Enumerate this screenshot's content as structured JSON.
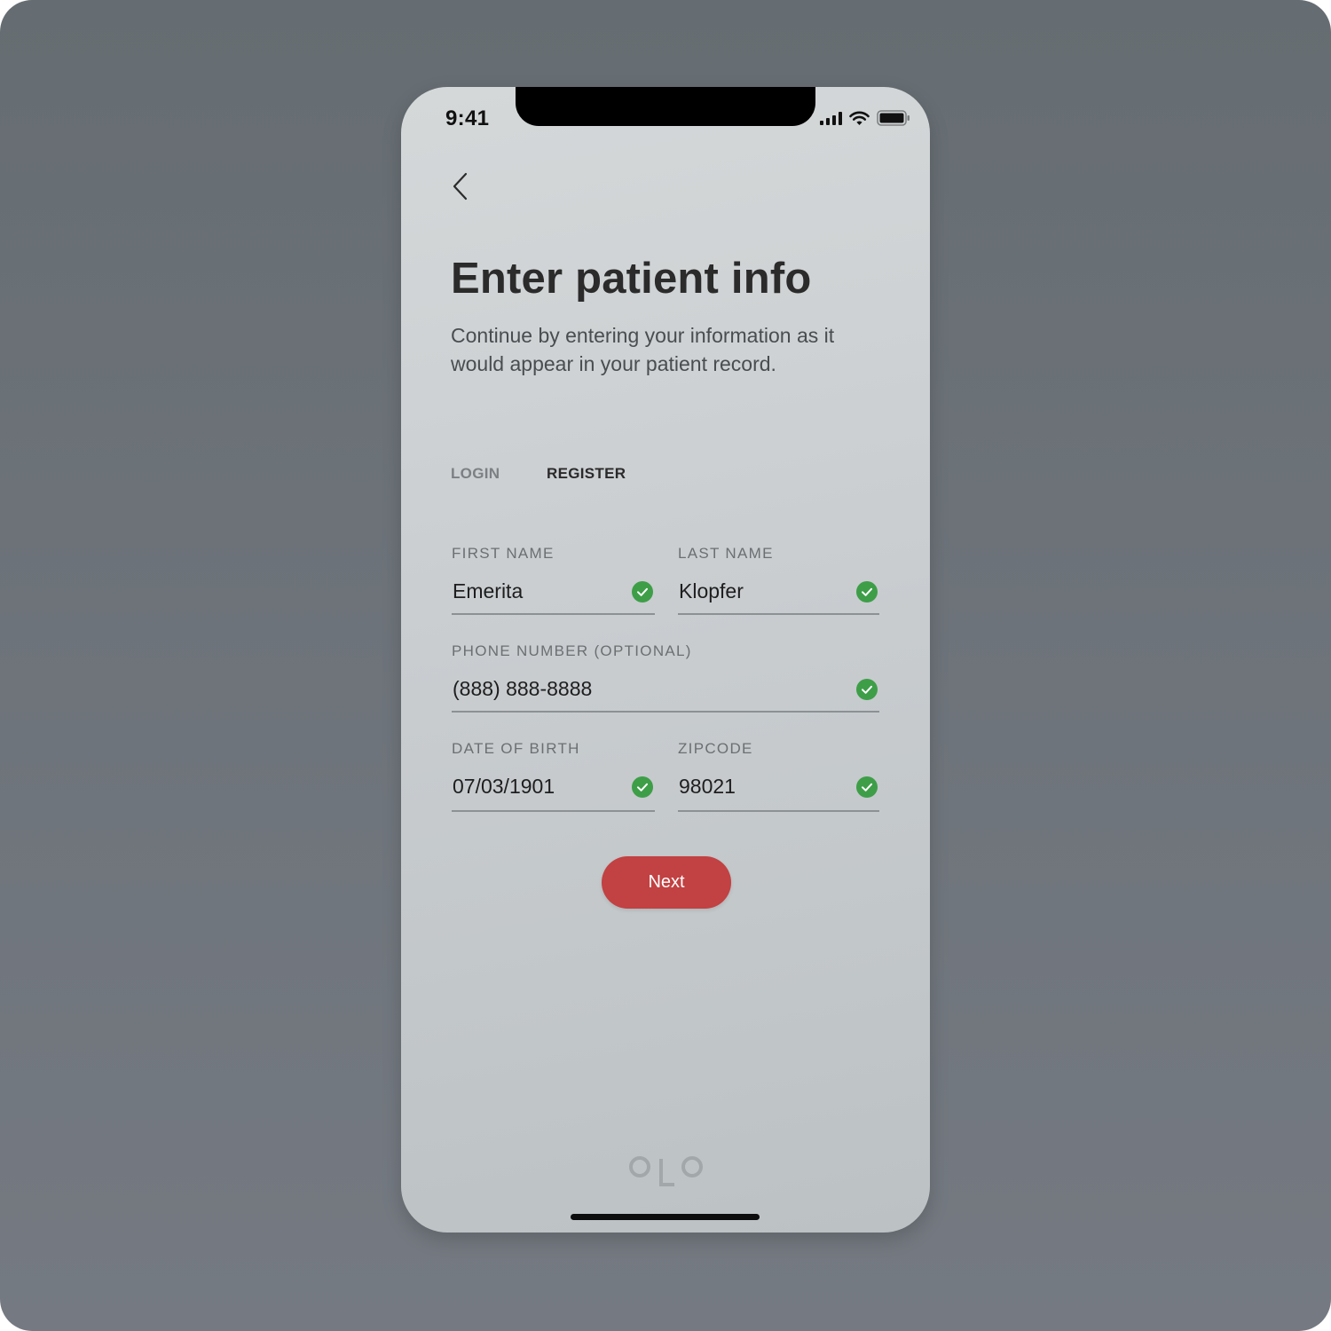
{
  "status_bar": {
    "time": "9:41",
    "icons": [
      "cellular-signal-icon",
      "wifi-icon",
      "battery-icon"
    ]
  },
  "header": {
    "back_icon": "chevron-left-icon",
    "title": "Enter patient info",
    "subtitle": "Continue by entering your information as it would appear in your patient record."
  },
  "tabs": [
    {
      "label": "LOGIN",
      "active": false
    },
    {
      "label": "REGISTER",
      "active": true
    }
  ],
  "form": {
    "first_name": {
      "label": "FIRST NAME",
      "value": "Emerita",
      "valid": true
    },
    "last_name": {
      "label": "LAST NAME",
      "value": "Klopfer",
      "valid": true
    },
    "phone": {
      "label": "PHONE NUMBER (OPTIONAL)",
      "value": "(888) 888-8888",
      "valid": true
    },
    "dob": {
      "label": "DATE OF BIRTH",
      "value": "07/03/1901",
      "valid": true
    },
    "zipcode": {
      "label": "ZIPCODE",
      "value": "98021",
      "valid": true
    }
  },
  "actions": {
    "next_label": "Next"
  },
  "branding": {
    "logo_text": "OLO"
  },
  "colors": {
    "accent": "#c24142",
    "valid_check": "#3e9e48",
    "title_text": "#2b2b2b",
    "background": "#6b7177"
  }
}
